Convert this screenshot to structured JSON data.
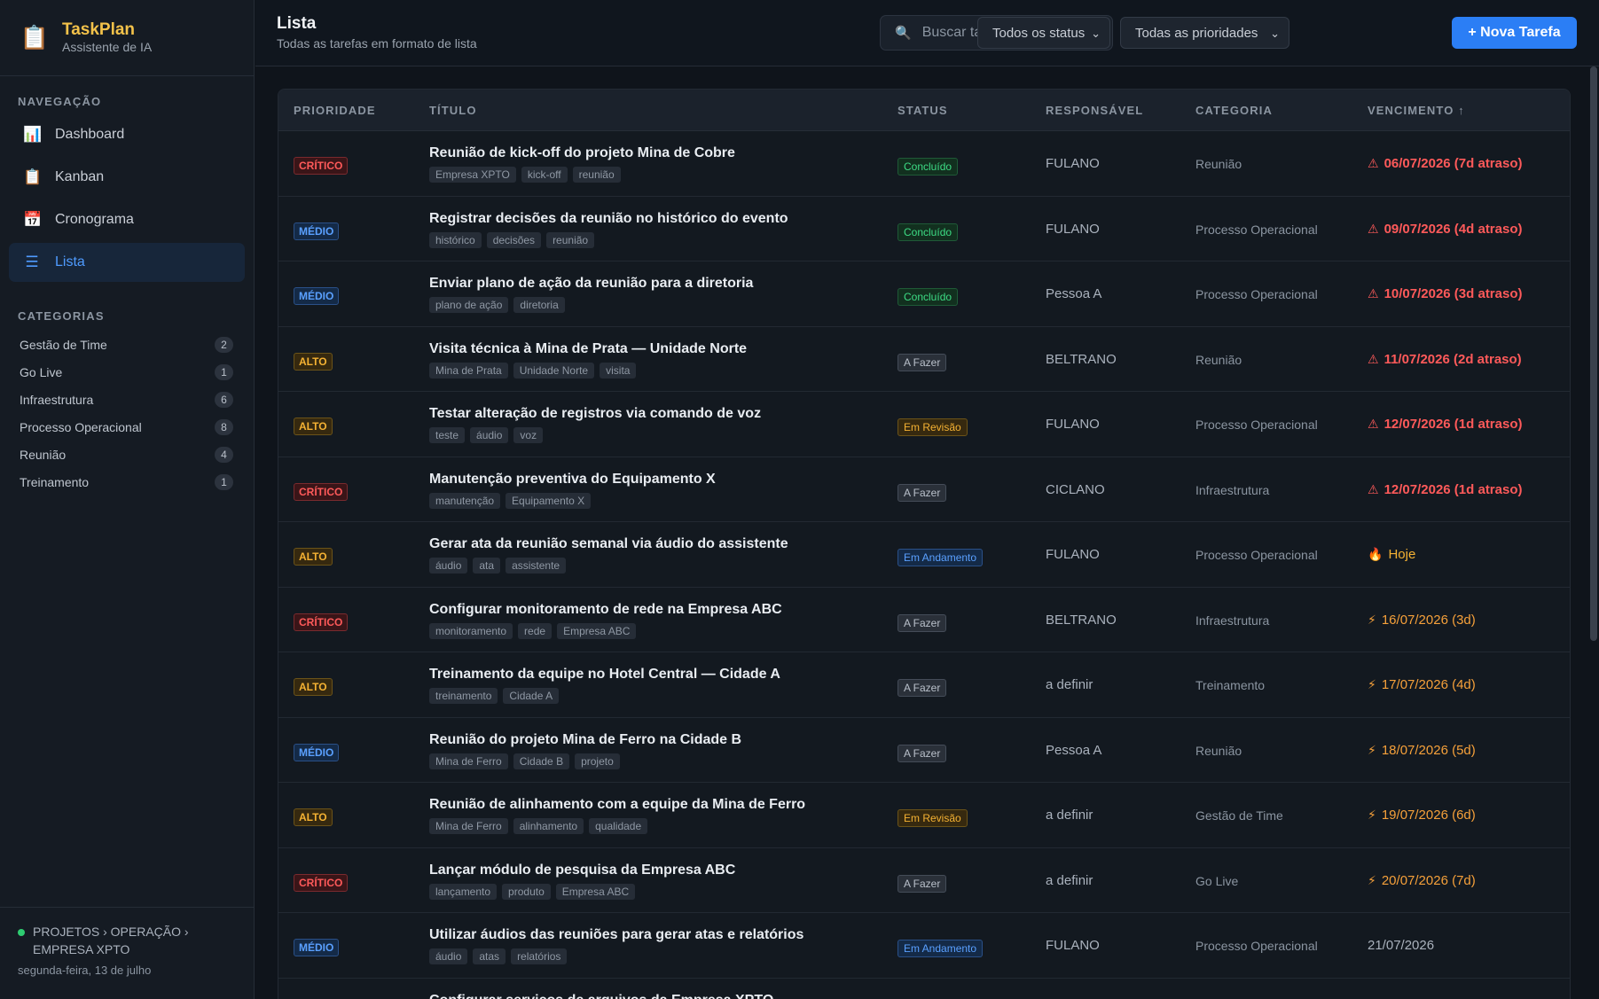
{
  "app": {
    "name": "TaskPlan",
    "subtitle": "Assistente de IA",
    "icon": "clipboard-icon"
  },
  "nav": {
    "title": "NAVEGAÇÃO",
    "items": [
      {
        "label": "Dashboard",
        "icon": "chart-icon",
        "active": false
      },
      {
        "label": "Kanban",
        "icon": "clipboard-icon",
        "active": false
      },
      {
        "label": "Cronograma",
        "icon": "calendar-icon",
        "active": false
      },
      {
        "label": "Lista",
        "icon": "list-icon",
        "active": true
      }
    ]
  },
  "categories": {
    "title": "CATEGORIAS",
    "items": [
      {
        "label": "Gestão de Time",
        "count": "2"
      },
      {
        "label": "Go Live",
        "count": "1"
      },
      {
        "label": "Infraestrutura",
        "count": "6"
      },
      {
        "label": "Processo Operacional",
        "count": "8"
      },
      {
        "label": "Reunião",
        "count": "4"
      },
      {
        "label": "Treinamento",
        "count": "1"
      }
    ]
  },
  "footer": {
    "breadcrumb": "PROJETOS › OPERAÇÃO › EMPRESA XPTO",
    "date": "segunda-feira, 13 de julho"
  },
  "header": {
    "title": "Lista",
    "subtitle": "Todas as tarefas em formato de lista",
    "search_placeholder": "Buscar tarefas...",
    "status_filter": "Todos os status",
    "priority_filter": "Todas as prioridades",
    "new_button": "+ Nova Tarefa"
  },
  "table": {
    "columns": [
      "PRIORIDADE",
      "TÍTULO",
      "STATUS",
      "RESPONSÁVEL",
      "CATEGORIA",
      "VENCIMENTO ↑"
    ],
    "rows": [
      {
        "priority": "CRÍTICO",
        "title": "Reunião de kick-off do projeto Mina de Cobre",
        "tags": [
          "Empresa XPTO",
          "kick-off",
          "reunião"
        ],
        "status": "Concluído",
        "status_class": "Concluído",
        "owner": "FULANO",
        "category": "Reunião",
        "due": "06/07/2026 (7d atraso)",
        "due_type": "overdue",
        "due_icon": "⚠"
      },
      {
        "priority": "MÉDIO",
        "title": "Registrar decisões da reunião no histórico do evento",
        "tags": [
          "histórico",
          "decisões",
          "reunião"
        ],
        "status": "Concluído",
        "status_class": "Concluído",
        "owner": "FULANO",
        "category": "Processo Operacional",
        "due": "09/07/2026 (4d atraso)",
        "due_type": "overdue",
        "due_icon": "⚠"
      },
      {
        "priority": "MÉDIO",
        "title": "Enviar plano de ação da reunião para a diretoria",
        "tags": [
          "plano de ação",
          "diretoria"
        ],
        "status": "Concluído",
        "status_class": "Concluído",
        "owner": "Pessoa A",
        "category": "Processo Operacional",
        "due": "10/07/2026 (3d atraso)",
        "due_type": "overdue",
        "due_icon": "⚠"
      },
      {
        "priority": "ALTO",
        "title": "Visita técnica à Mina de Prata — Unidade Norte",
        "tags": [
          "Mina de Prata",
          "Unidade Norte",
          "visita"
        ],
        "status": "A Fazer",
        "status_class": "AFazer",
        "owner": "BELTRANO",
        "category": "Reunião",
        "due": "11/07/2026 (2d atraso)",
        "due_type": "overdue",
        "due_icon": "⚠"
      },
      {
        "priority": "ALTO",
        "title": "Testar alteração de registros via comando de voz",
        "tags": [
          "teste",
          "áudio",
          "voz"
        ],
        "status": "Em Revisão",
        "status_class": "EmRevisao",
        "owner": "FULANO",
        "category": "Processo Operacional",
        "due": "12/07/2026 (1d atraso)",
        "due_type": "overdue",
        "due_icon": "⚠"
      },
      {
        "priority": "CRÍTICO",
        "title": "Manutenção preventiva do Equipamento X",
        "tags": [
          "manutenção",
          "Equipamento X"
        ],
        "status": "A Fazer",
        "status_class": "AFazer",
        "owner": "CICLANO",
        "category": "Infraestrutura",
        "due": "12/07/2026 (1d atraso)",
        "due_type": "overdue",
        "due_icon": "⚠"
      },
      {
        "priority": "ALTO",
        "title": "Gerar ata da reunião semanal via áudio do assistente",
        "tags": [
          "áudio",
          "ata",
          "assistente"
        ],
        "status": "Em Andamento",
        "status_class": "EmAndamento",
        "owner": "FULANO",
        "category": "Processo Operacional",
        "due": "Hoje",
        "due_type": "today",
        "due_icon": "🔥"
      },
      {
        "priority": "CRÍTICO",
        "title": "Configurar monitoramento de rede na Empresa ABC",
        "tags": [
          "monitoramento",
          "rede",
          "Empresa ABC"
        ],
        "status": "A Fazer",
        "status_class": "AFazer",
        "owner": "BELTRANO",
        "category": "Infraestrutura",
        "due": "16/07/2026 (3d)",
        "due_type": "soon",
        "due_icon": "⚡"
      },
      {
        "priority": "ALTO",
        "title": "Treinamento da equipe no Hotel Central — Cidade A",
        "tags": [
          "treinamento",
          "Cidade A"
        ],
        "status": "A Fazer",
        "status_class": "AFazer",
        "owner": "a definir",
        "category": "Treinamento",
        "due": "17/07/2026 (4d)",
        "due_type": "soon",
        "due_icon": "⚡"
      },
      {
        "priority": "MÉDIO",
        "title": "Reunião do projeto Mina de Ferro na Cidade B",
        "tags": [
          "Mina de Ferro",
          "Cidade B",
          "projeto"
        ],
        "status": "A Fazer",
        "status_class": "AFazer",
        "owner": "Pessoa A",
        "category": "Reunião",
        "due": "18/07/2026 (5d)",
        "due_type": "soon",
        "due_icon": "⚡"
      },
      {
        "priority": "ALTO",
        "title": "Reunião de alinhamento com a equipe da Mina de Ferro",
        "tags": [
          "Mina de Ferro",
          "alinhamento",
          "qualidade"
        ],
        "status": "Em Revisão",
        "status_class": "EmRevisao",
        "owner": "a definir",
        "category": "Gestão de Time",
        "due": "19/07/2026 (6d)",
        "due_type": "soon",
        "due_icon": "⚡"
      },
      {
        "priority": "CRÍTICO",
        "title": "Lançar módulo de pesquisa da Empresa ABC",
        "tags": [
          "lançamento",
          "produto",
          "Empresa ABC"
        ],
        "status": "A Fazer",
        "status_class": "AFazer",
        "owner": "a definir",
        "category": "Go Live",
        "due": "20/07/2026 (7d)",
        "due_type": "soon",
        "due_icon": "⚡"
      },
      {
        "priority": "MÉDIO",
        "title": "Utilizar áudios das reuniões para gerar atas e relatórios",
        "tags": [
          "áudio",
          "atas",
          "relatórios"
        ],
        "status": "Em Andamento",
        "status_class": "EmAndamento",
        "owner": "FULANO",
        "category": "Processo Operacional",
        "due": "21/07/2026",
        "due_type": "normal",
        "due_icon": ""
      },
      {
        "priority": "",
        "title": "Configurar serviços de arquivos da Empresa XPTO",
        "tags": [],
        "status": "",
        "status_class": "",
        "owner": "",
        "category": "",
        "due": "",
        "due_type": "normal",
        "due_icon": ""
      }
    ]
  }
}
